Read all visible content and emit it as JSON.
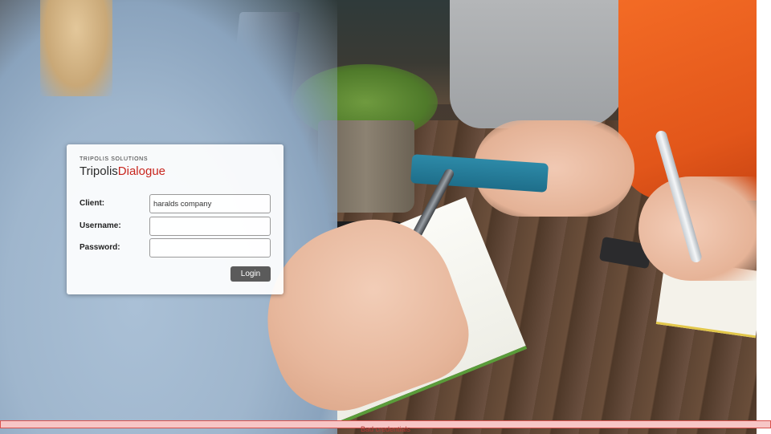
{
  "login": {
    "brand_tagline": "TRIPOLIS SOLUTIONS",
    "brand_name_part1": "Tripolis",
    "brand_name_part2": "Dialogue",
    "client_label": "Client:",
    "client_value": "haralds company",
    "username_label": "Username:",
    "username_value": "",
    "password_label": "Password:",
    "password_value": "",
    "login_button": "Login"
  },
  "error": {
    "message": "Bad credentials"
  },
  "colors": {
    "brand_red": "#c8261e",
    "button_bg": "#5b5b5b",
    "error_border": "#d9534f",
    "error_bg": "#f7c6c6"
  }
}
